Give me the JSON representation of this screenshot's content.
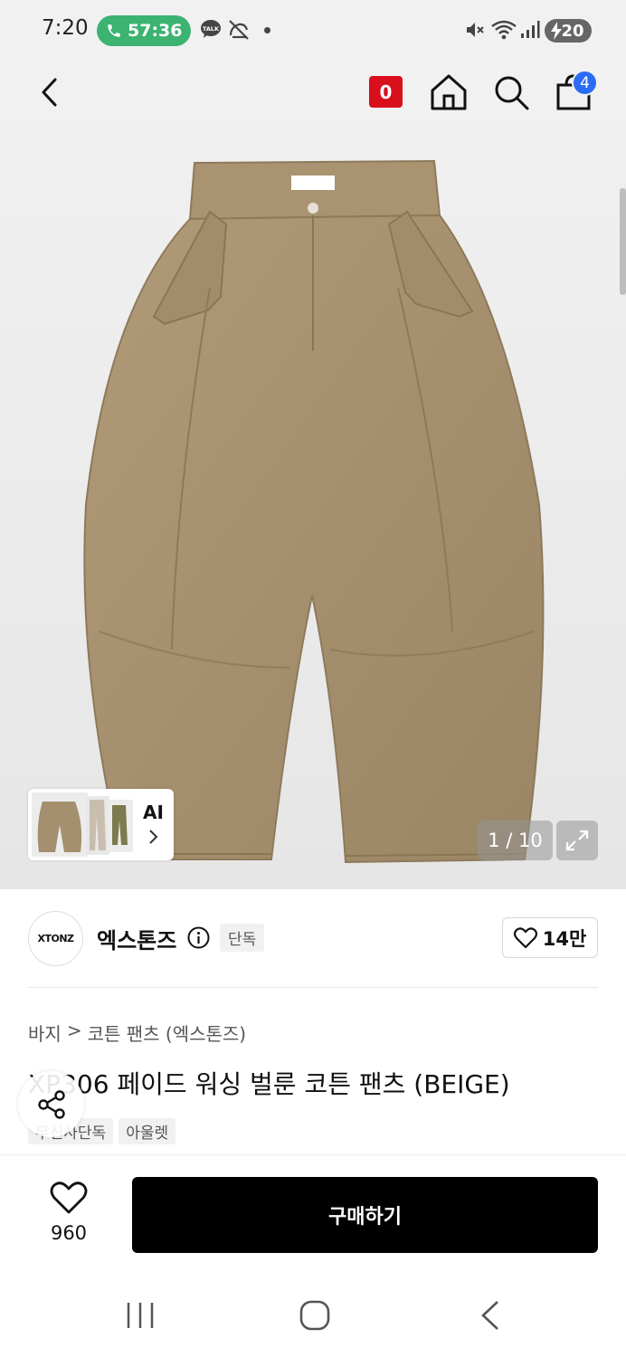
{
  "status_bar": {
    "time": "7:20",
    "call_timer": "57:36",
    "talk_label": "TALK",
    "battery": "20"
  },
  "header": {
    "notification_count": "0",
    "cart_count": "4"
  },
  "gallery": {
    "ai_label": "AI",
    "page_counter": "1 / 10"
  },
  "brand": {
    "logo_text": "XTONZ",
    "name": "엑스톤즈",
    "exclusive_tag": "단독",
    "like_count": "14만"
  },
  "product": {
    "breadcrumb": [
      "바지",
      ">",
      "코튼 팬츠 (엑스톤즈)"
    ],
    "title": "XP306 페이드 워싱 벌룬 코튼 팬츠 (BEIGE)",
    "tags": [
      "무신사단독",
      "아울렛"
    ]
  },
  "action_bar": {
    "wish_count": "960",
    "buy_label": "구매하기"
  },
  "colors": {
    "call_green": "#3cb371",
    "brand_red": "#d90f1c",
    "cart_blue": "#2b6cf6",
    "buy_black": "#000000",
    "pants_khaki": "#a48f6e"
  }
}
